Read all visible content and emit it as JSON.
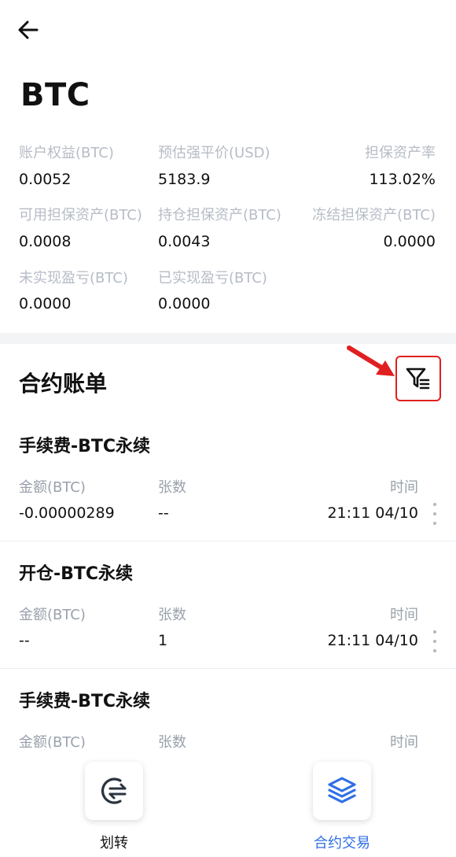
{
  "header": {
    "title": "BTC"
  },
  "summary": [
    {
      "label": "账户权益(BTC)",
      "value": "0.0052"
    },
    {
      "label": "预估强平价(USD)",
      "value": "5183.9"
    },
    {
      "label": "担保资产率",
      "value": "113.02%"
    },
    {
      "label": "可用担保资产(BTC)",
      "value": "0.0008"
    },
    {
      "label": "持仓担保资产(BTC)",
      "value": "0.0043"
    },
    {
      "label": "冻结担保资产(BTC)",
      "value": "0.0000"
    },
    {
      "label": "未实现盈亏(BTC)",
      "value": "0.0000"
    },
    {
      "label": "已实现盈亏(BTC)",
      "value": "0.0000"
    }
  ],
  "bills": {
    "title": "合约账单",
    "items": [
      {
        "title": "手续费-BTC永续",
        "amount_label": "金额(BTC)",
        "count_label": "张数",
        "time_label": "时间",
        "amount": "-0.00000289",
        "count": "--",
        "time": "21:11 04/10"
      },
      {
        "title": "开仓-BTC永续",
        "amount_label": "金额(BTC)",
        "count_label": "张数",
        "time_label": "时间",
        "amount": "--",
        "count": "1",
        "time": "21:11 04/10"
      },
      {
        "title": "手续费-BTC永续",
        "amount_label": "金额(BTC)",
        "count_label": "张数",
        "time_label": "时间"
      }
    ]
  },
  "bottom_bar": {
    "transfer_label": "划转",
    "contract_label": "合约交易"
  },
  "colors": {
    "accent": "#2f6fe4",
    "highlight": "#e02020",
    "label_gray": "#b6bcc6"
  }
}
